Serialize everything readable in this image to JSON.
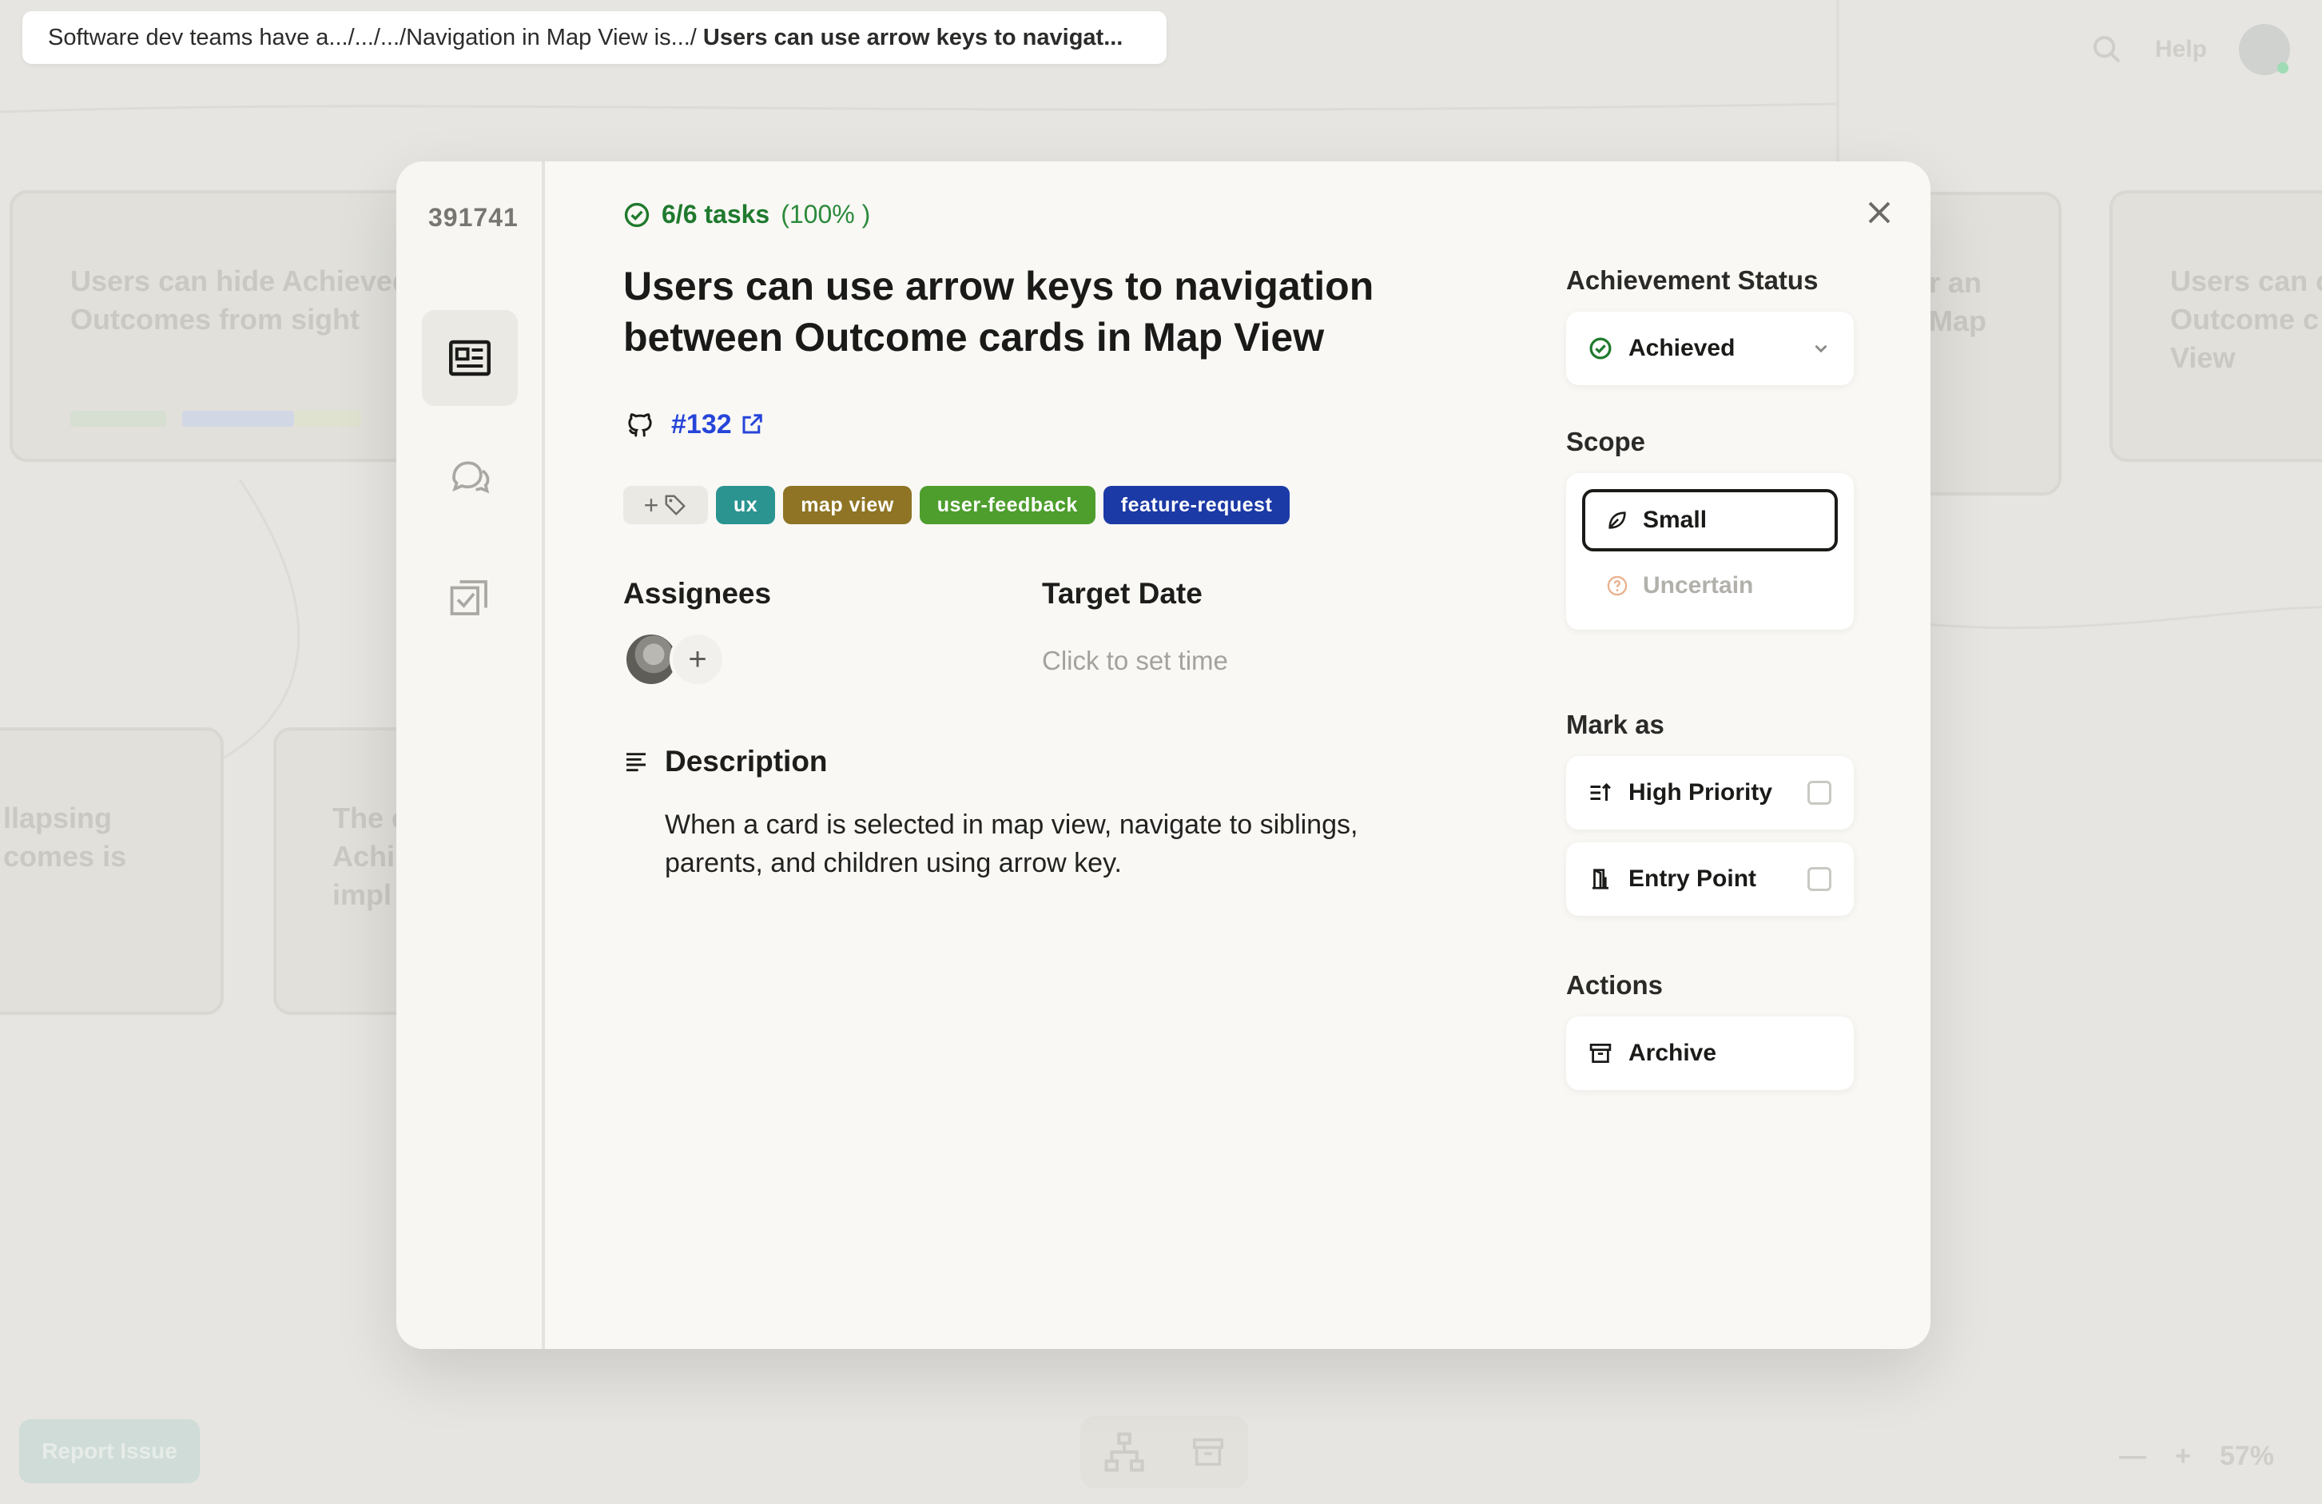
{
  "breadcrumb": {
    "trail": "Software dev teams have a.../.../.../Navigation in Map View is.../ ",
    "current": "Users can use arrow keys to navigat..."
  },
  "background": {
    "help_label": "Help",
    "report_issue": "Report Issue",
    "zoom_minus": "—",
    "zoom_plus": "+",
    "zoom_level": "57%",
    "cards": [
      {
        "title": "Users can hide Achieved Outcomes from sight"
      },
      {
        "title": "r an\nMap"
      },
      {
        "title": "Users can c\nOutcome c\nView"
      },
      {
        "title": "llapsing\ncomes is"
      },
      {
        "title": "The c\nAchi\nimpl"
      }
    ]
  },
  "modal": {
    "id": "391741",
    "rail": [
      {
        "name": "details",
        "icon": "details-card-icon",
        "active": true
      },
      {
        "name": "comments",
        "icon": "chat-bubbles-icon",
        "active": false
      },
      {
        "name": "tasks",
        "icon": "tasks-checklist-icon",
        "active": false
      }
    ],
    "tasks": {
      "count": "6/6 tasks",
      "percent": "(100% )"
    },
    "title": "Users can use arrow keys to navigation between Outcome cards in Map View",
    "issue": {
      "number": "#132",
      "icon": "github-icon",
      "link_icon": "external-link-icon"
    },
    "tags": [
      {
        "label": "ux",
        "color": "#2b9490"
      },
      {
        "label": "map view",
        "color": "#8e7424"
      },
      {
        "label": "user-feedback",
        "color": "#4e9e2e"
      },
      {
        "label": "feature-request",
        "color": "#1c3aa6"
      }
    ],
    "add_tag_label": "+",
    "assignees": {
      "heading": "Assignees",
      "add_label": "+"
    },
    "target_date": {
      "heading": "Target Date",
      "placeholder": "Click to set time"
    },
    "description": {
      "heading": "Description",
      "text": "When a card is selected in map view, navigate to siblings, parents, and children using arrow key."
    },
    "achievement": {
      "heading": "Achievement Status",
      "value": "Achieved",
      "color": "#1f7a2d"
    },
    "scope": {
      "heading": "Scope",
      "options": [
        {
          "label": "Small",
          "icon": "leaf-icon",
          "selected": true
        },
        {
          "label": "Uncertain",
          "icon": "question-circle-icon",
          "selected": false
        }
      ]
    },
    "mark_as": {
      "heading": "Mark as",
      "items": [
        {
          "label": "High Priority",
          "icon": "priority-arrow-icon",
          "checked": false
        },
        {
          "label": "Entry Point",
          "icon": "door-icon",
          "checked": false
        }
      ]
    },
    "actions": {
      "heading": "Actions",
      "archive_label": "Archive"
    }
  }
}
